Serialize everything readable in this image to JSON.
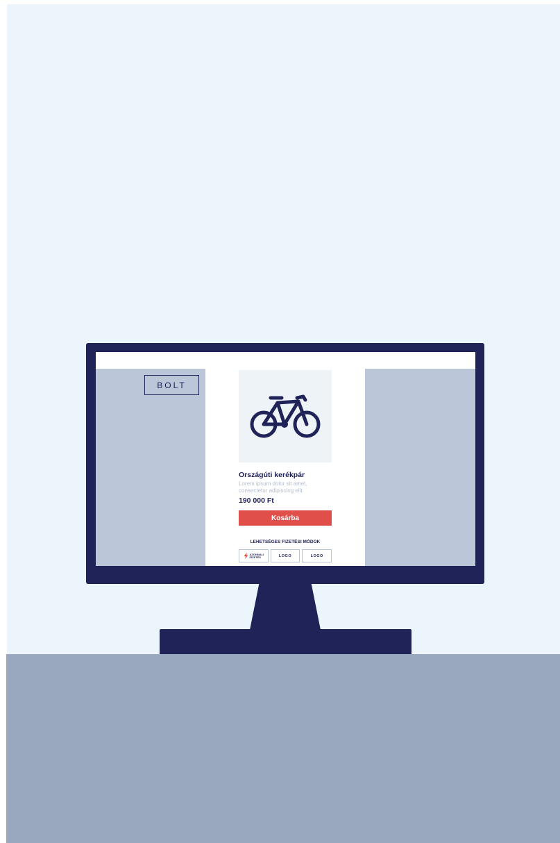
{
  "shop": {
    "logo_label": "BOLT"
  },
  "product": {
    "image_icon": "bicycle-icon",
    "name": "Országúti kerékpár",
    "description": "Lorem ipsum dolor sit amet, consectetur adipiscing elit",
    "price": "190 000 Ft",
    "cart_button_label": "Kosárba"
  },
  "payment": {
    "title": "LEHETSÉGES FIZETÉSI MÓDOK",
    "options": [
      {
        "icon": "lightning-icon",
        "label_line1": "AZONNALI",
        "label_line2": "FIZETÉS"
      },
      {
        "label": "LOGO"
      },
      {
        "label": "LOGO"
      }
    ]
  },
  "colors": {
    "monitor": "#202357",
    "wall": "#edf5fc",
    "floor": "#99a8be",
    "side_panels": "#bbc7d9",
    "accent_button": "#e04f4a",
    "text_primary": "#202357",
    "text_muted": "#b4bfd0"
  }
}
